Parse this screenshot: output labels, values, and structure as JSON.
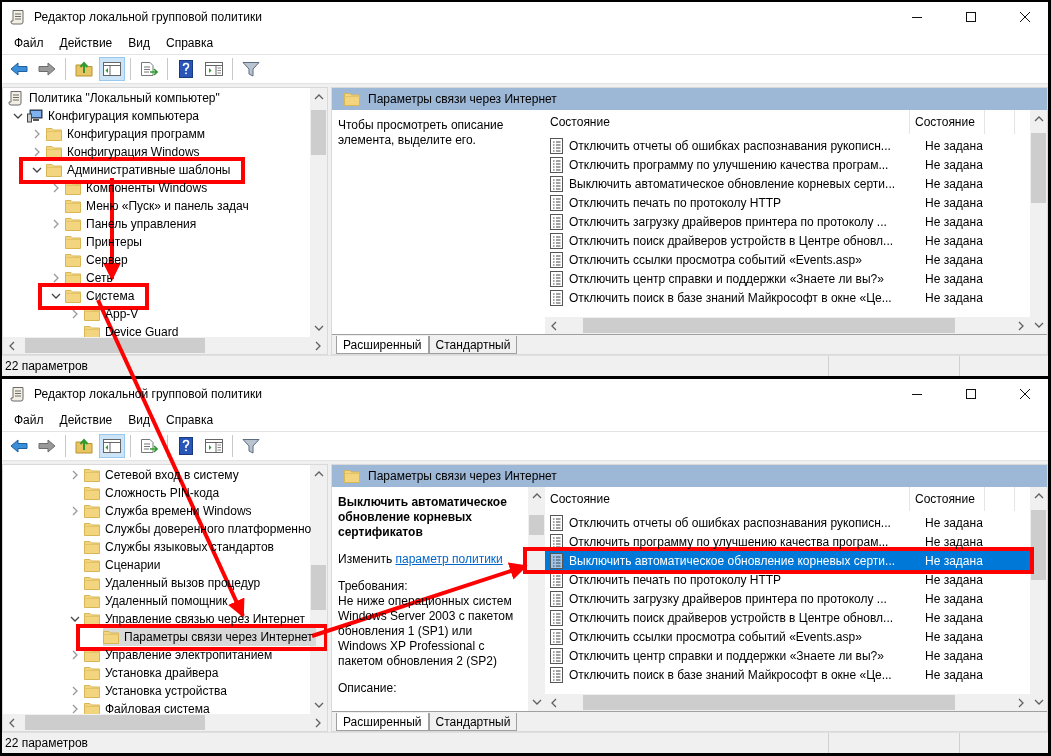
{
  "windows": [
    {
      "title": "Редактор локальной групповой политики",
      "menu": [
        "Файл",
        "Действие",
        "Вид",
        "Справка"
      ],
      "toolbar": [
        {
          "kind": "back",
          "pressed": false
        },
        {
          "kind": "forward",
          "pressed": false
        },
        {
          "kind": "separator"
        },
        {
          "kind": "up",
          "pressed": false
        },
        {
          "kind": "tree",
          "pressed": true
        },
        {
          "kind": "separator"
        },
        {
          "kind": "export",
          "pressed": false
        },
        {
          "kind": "separator"
        },
        {
          "kind": "help",
          "pressed": false
        },
        {
          "kind": "view",
          "pressed": false
        },
        {
          "kind": "separator"
        },
        {
          "kind": "filter",
          "pressed": false
        }
      ],
      "tree": [
        {
          "label": "Политика \"Локальный компьютер\"",
          "kind": "policy",
          "selected": false,
          "annotated": false,
          "children": [
            {
              "label": "Конфигурация компьютера",
              "kind": "computer",
              "expanded": true,
              "selected": false,
              "annotated": false,
              "children": [
                {
                  "label": "Конфигурация программ",
                  "kind": "folder",
                  "expanded": false,
                  "selected": false,
                  "annotated": false
                },
                {
                  "label": "Конфигурация Windows",
                  "kind": "folder",
                  "expanded": false,
                  "selected": false,
                  "annotated": false
                },
                {
                  "label": "Административные шаблоны",
                  "kind": "folder",
                  "expanded": true,
                  "selected": false,
                  "annotated": true,
                  "children": [
                    {
                      "label": "Компоненты Windows",
                      "kind": "folder",
                      "expanded": false,
                      "selected": false,
                      "annotated": false
                    },
                    {
                      "label": "Меню «Пуск» и панель задач",
                      "kind": "folder",
                      "selected": false,
                      "annotated": false
                    },
                    {
                      "label": "Панель управления",
                      "kind": "folder",
                      "expanded": false,
                      "selected": false,
                      "annotated": false
                    },
                    {
                      "label": "Принтеры",
                      "kind": "folder",
                      "selected": false,
                      "annotated": false
                    },
                    {
                      "label": "Сервер",
                      "kind": "folder",
                      "selected": false,
                      "annotated": false
                    },
                    {
                      "label": "Сеть",
                      "kind": "folder",
                      "expanded": false,
                      "selected": false,
                      "annotated": false
                    },
                    {
                      "label": "Система",
                      "kind": "folder",
                      "expanded": true,
                      "selected": false,
                      "annotated": true,
                      "children": [
                        {
                          "label": "App-V",
                          "kind": "folder",
                          "expanded": false,
                          "selected": false,
                          "annotated": false
                        },
                        {
                          "label": "Device Guard",
                          "kind": "folder",
                          "selected": false,
                          "annotated": false
                        }
                      ]
                    }
                  ]
                }
              ]
            }
          ]
        }
      ],
      "panel": {
        "header": "Параметры связи через Интернет",
        "description": {
          "kind": "hint",
          "text": "Чтобы просмотреть описание элемента, выделите его."
        },
        "columns": [
          "Состояние",
          "Состояние"
        ],
        "rows": [
          {
            "name": "Отключить отчеты об ошибках распознавания рукописн...",
            "state": "Не задана",
            "selected": false,
            "annotated": false
          },
          {
            "name": "Отключить программу по улучшению качества програм...",
            "state": "Не задана",
            "selected": false,
            "annotated": false
          },
          {
            "name": "Выключить автоматическое обновление корневых серти...",
            "state": "Не задана",
            "selected": false,
            "annotated": false
          },
          {
            "name": "Отключить печать по протоколу HTTP",
            "state": "Не задана",
            "selected": false,
            "annotated": false
          },
          {
            "name": "Отключить загрузку драйверов принтера по протоколу ...",
            "state": "Не задана",
            "selected": false,
            "annotated": false
          },
          {
            "name": "Отключить поиск драйверов устройств в Центре обновл...",
            "state": "Не задана",
            "selected": false,
            "annotated": false
          },
          {
            "name": "Отключить ссылки просмотра событий «Events.asp»",
            "state": "Не задана",
            "selected": false,
            "annotated": false
          },
          {
            "name": "Отключить центр справки и поддержки «Знаете ли вы?»",
            "state": "Не задана",
            "selected": false,
            "annotated": false
          },
          {
            "name": "Отключить поиск в базе знаний Майкрософт в окне «Це...",
            "state": "Не задана",
            "selected": false,
            "annotated": false
          }
        ],
        "tabs": [
          {
            "label": "Расширенный",
            "selected": true
          },
          {
            "label": "Стандартный",
            "selected": false
          }
        ]
      },
      "status": "22 параметров"
    },
    {
      "title": "Редактор локальной групповой политики",
      "menu": [
        "Файл",
        "Действие",
        "Вид",
        "Справка"
      ],
      "toolbar": [
        {
          "kind": "back",
          "pressed": false
        },
        {
          "kind": "forward",
          "pressed": false
        },
        {
          "kind": "separator"
        },
        {
          "kind": "up",
          "pressed": false
        },
        {
          "kind": "tree",
          "pressed": true
        },
        {
          "kind": "separator"
        },
        {
          "kind": "export",
          "pressed": false
        },
        {
          "kind": "separator"
        },
        {
          "kind": "help",
          "pressed": false
        },
        {
          "kind": "view",
          "pressed": false
        },
        {
          "kind": "separator"
        },
        {
          "kind": "filter",
          "pressed": false
        }
      ],
      "tree": [
        {
          "label": "Сетевой вход в систему",
          "kind": "folder",
          "expanded": false,
          "selected": false,
          "annotated": false
        },
        {
          "label": "Сложность PIN-кода",
          "kind": "folder",
          "selected": false,
          "annotated": false
        },
        {
          "label": "Служба времени Windows",
          "kind": "folder",
          "expanded": false,
          "selected": false,
          "annotated": false
        },
        {
          "label": "Службы доверенного платформенно",
          "kind": "folder",
          "selected": false,
          "annotated": false
        },
        {
          "label": "Службы языковых стандартов",
          "kind": "folder",
          "selected": false,
          "annotated": false
        },
        {
          "label": "Сценарии",
          "kind": "folder",
          "selected": false,
          "annotated": false
        },
        {
          "label": "Удаленный вызов процедур",
          "kind": "folder",
          "selected": false,
          "annotated": false
        },
        {
          "label": "Удаленный помощник",
          "kind": "folder",
          "selected": false,
          "annotated": false
        },
        {
          "label": "Управление связью через Интернет",
          "kind": "folder",
          "expanded": true,
          "selected": false,
          "annotated": false,
          "children": [
            {
              "label": "Параметры связи через Интернет",
              "kind": "folder",
              "selected": true,
              "annotated": true
            }
          ]
        },
        {
          "label": "Управление электропитанием",
          "kind": "folder",
          "expanded": false,
          "selected": false,
          "annotated": false
        },
        {
          "label": "Установка драйвера",
          "kind": "folder",
          "selected": false,
          "annotated": false
        },
        {
          "label": "Установка устройства",
          "kind": "folder",
          "expanded": false,
          "selected": false,
          "annotated": false
        },
        {
          "label": "Файловая система",
          "kind": "folder",
          "expanded": false,
          "selected": false,
          "annotated": false
        }
      ],
      "panel": {
        "header": "Параметры связи через Интернет",
        "description": {
          "kind": "details",
          "title": "Выключить автоматическое обновление корневых сертификатов",
          "edit_prefix": "Изменить",
          "edit_link": "параметр политики",
          "requirements_label": "Требования:",
          "requirements": "Не ниже операционных систем Windows Server 2003 с пакетом обновления 1 (SP1) или Windows XP Professional с пакетом обновления 2 (SP2)",
          "description_label": "Описание:"
        },
        "columns": [
          "Состояние",
          "Состояние"
        ],
        "rows": [
          {
            "name": "Отключить отчеты об ошибках распознавания рукописн...",
            "state": "Не задана",
            "selected": false,
            "annotated": false
          },
          {
            "name": "Отключить программу по улучшению качества програм...",
            "state": "Не задана",
            "selected": false,
            "annotated": false
          },
          {
            "name": "Выключить автоматическое обновление корневых серти...",
            "state": "Не задана",
            "selected": true,
            "annotated": true
          },
          {
            "name": "Отключить печать по протоколу HTTP",
            "state": "Не задана",
            "selected": false,
            "annotated": false
          },
          {
            "name": "Отключить загрузку драйверов принтера по протоколу ...",
            "state": "Не задана",
            "selected": false,
            "annotated": false
          },
          {
            "name": "Отключить поиск драйверов устройств в Центре обновл...",
            "state": "Не задана",
            "selected": false,
            "annotated": false
          },
          {
            "name": "Отключить ссылки просмотра событий «Events.asp»",
            "state": "Не задана",
            "selected": false,
            "annotated": false
          },
          {
            "name": "Отключить центр справки и поддержки «Знаете ли вы?»",
            "state": "Не задана",
            "selected": false,
            "annotated": false
          },
          {
            "name": "Отключить поиск в базе знаний Майкрософт в окне «Це...",
            "state": "Не задана",
            "selected": false,
            "annotated": false
          }
        ],
        "tabs": [
          {
            "label": "Расширенный",
            "selected": true
          },
          {
            "label": "Стандартный",
            "selected": false
          }
        ]
      },
      "status": "22 параметров"
    }
  ]
}
